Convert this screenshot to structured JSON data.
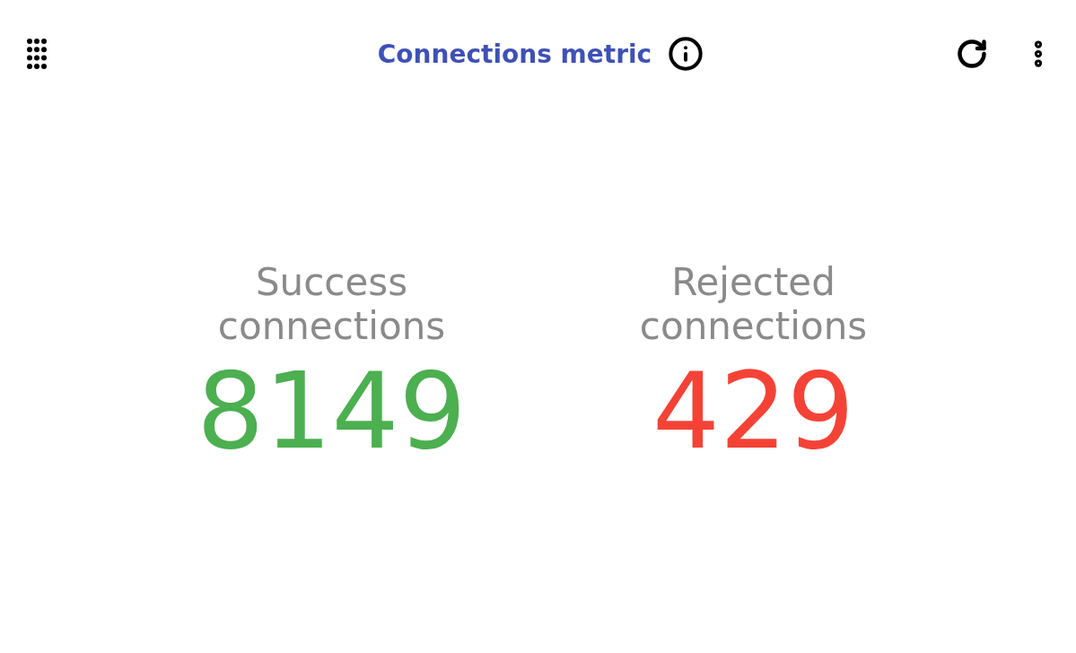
{
  "header": {
    "title": "Connections metric"
  },
  "metrics": [
    {
      "label": "Success connections",
      "value": "8149",
      "color": "#4caf50"
    },
    {
      "label": "Rejected connections",
      "value": "429",
      "color": "#f44336"
    }
  ]
}
